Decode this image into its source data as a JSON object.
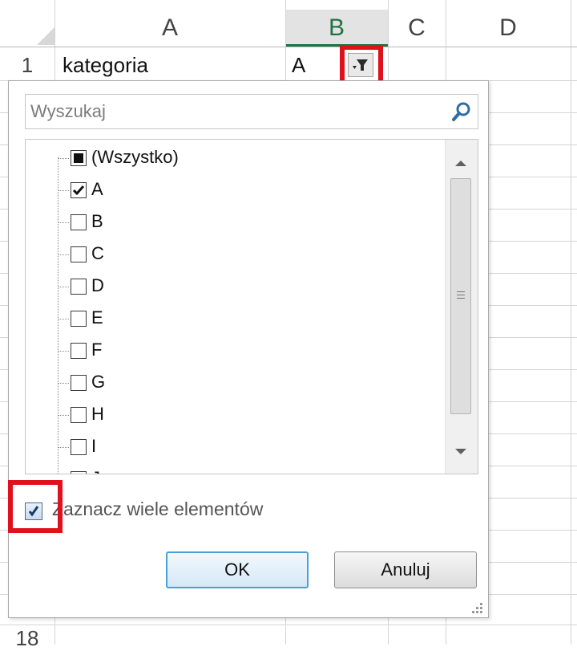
{
  "sheet": {
    "columns": [
      "A",
      "B",
      "C",
      "D"
    ],
    "rows": [
      {
        "num": "1",
        "cells": [
          "kategoria",
          "A"
        ]
      },
      {
        "num": "18",
        "cells": []
      }
    ]
  },
  "filter_dropdown": {
    "search_placeholder": "Wyszukaj",
    "items": [
      {
        "label": "(Wszystko)",
        "state": "indeterminate"
      },
      {
        "label": "A",
        "state": "checked"
      },
      {
        "label": "B",
        "state": "unchecked"
      },
      {
        "label": "C",
        "state": "unchecked"
      },
      {
        "label": "D",
        "state": "unchecked"
      },
      {
        "label": "E",
        "state": "unchecked"
      },
      {
        "label": "F",
        "state": "unchecked"
      },
      {
        "label": "G",
        "state": "unchecked"
      },
      {
        "label": "H",
        "state": "unchecked"
      },
      {
        "label": "I",
        "state": "unchecked"
      },
      {
        "label": "J",
        "state": "unchecked"
      }
    ],
    "select_multiple_label": "Zaznacz wiele elementów",
    "select_multiple_checked": true,
    "ok_label": "OK",
    "cancel_label": "Anuluj"
  },
  "icons": {
    "search": "magnifier-icon",
    "filter": "filter-funnel-icon",
    "scroll_up": "arrow-up-icon",
    "scroll_down": "arrow-down-icon"
  },
  "colors": {
    "highlight": "#e0101d",
    "selected_column": "#217346",
    "ok_border": "#4a9fd8"
  }
}
